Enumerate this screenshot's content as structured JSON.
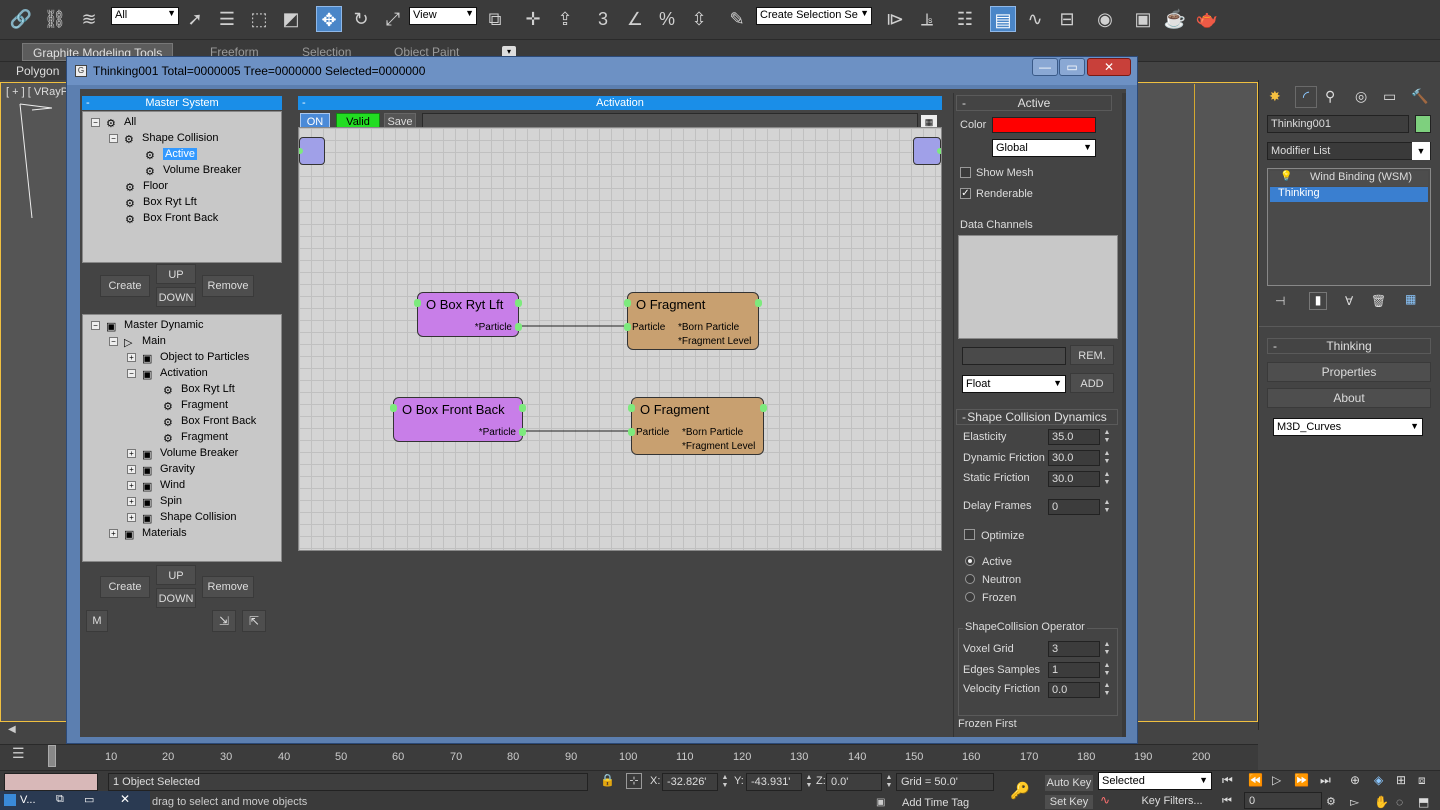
{
  "toolbar": {
    "filter_select": "All",
    "view_select": "View",
    "snap_label": "3",
    "selection_set": "Create Selection Se"
  },
  "ribbon": {
    "tabs": [
      "Graphite Modeling Tools",
      "Freeform",
      "Selection",
      "Object Paint"
    ],
    "sub_tab": "Polygon"
  },
  "viewport": {
    "label": "[ + ] [ VRayPh"
  },
  "dialog": {
    "title": "Thinking001  Total=0000005  Tree=0000000  Selected=0000000",
    "min": "—",
    "max": "▭",
    "close": "✕"
  },
  "master_system": {
    "header": "Master System",
    "items": [
      {
        "label": "All",
        "expander": "−"
      },
      {
        "label": "Shape Collision",
        "expander": "−"
      },
      {
        "label": "Active",
        "selected": true
      },
      {
        "label": "Volume Breaker"
      },
      {
        "label": "Floor"
      },
      {
        "label": "Box Ryt Lft"
      },
      {
        "label": "Box Front Back"
      }
    ],
    "create": "Create",
    "up": "UP",
    "down": "DOWN",
    "remove": "Remove"
  },
  "master_dynamic": {
    "items": [
      {
        "label": "Master Dynamic",
        "expander": "−"
      },
      {
        "label": "Main",
        "expander": "−"
      },
      {
        "label": "Object to Particles",
        "expander": "+"
      },
      {
        "label": "Activation",
        "expander": "−"
      },
      {
        "label": "Box Ryt Lft"
      },
      {
        "label": "Fragment"
      },
      {
        "label": "Box Front Back"
      },
      {
        "label": "Fragment"
      },
      {
        "label": "Volume Breaker",
        "expander": "+"
      },
      {
        "label": "Gravity",
        "expander": "+"
      },
      {
        "label": "Wind",
        "expander": "+"
      },
      {
        "label": "Spin",
        "expander": "+"
      },
      {
        "label": "Shape Collision",
        "expander": "+"
      },
      {
        "label": "Materials",
        "expander": "+"
      }
    ],
    "create": "Create",
    "up": "UP",
    "down": "DOWN",
    "remove": "Remove",
    "m": "M"
  },
  "activation": {
    "header": "Activation",
    "on": "ON",
    "valid": "Valid",
    "save": "Save",
    "nodes": [
      {
        "title": "O Box Ryt Lft",
        "port": "*Particle"
      },
      {
        "title": "O Fragment",
        "in": "Particle",
        "out1": "*Born Particle",
        "out2": "*Fragment Level"
      },
      {
        "title": "O Box Front Back",
        "port": "*Particle"
      },
      {
        "title": "O Fragment",
        "in": "Particle",
        "out1": "*Born Particle",
        "out2": "*Fragment Level"
      }
    ]
  },
  "props": {
    "active_header": "Active",
    "color_label": "Color",
    "color_value": "#ff0000",
    "space_select": "Global",
    "show_mesh": "Show Mesh",
    "renderable": "Renderable",
    "data_channels": "Data Channels",
    "rem": "REM.",
    "float_select": "Float",
    "add": "ADD",
    "scd_header": "Shape Collision Dynamics",
    "elasticity_label": "Elasticity",
    "elasticity": "35.0",
    "dyn_friction_label": "Dynamic Friction",
    "dyn_friction": "30.0",
    "static_friction_label": "Static Friction",
    "static_friction": "30.0",
    "delay_label": "Delay Frames",
    "delay": "0",
    "optimize": "Optimize",
    "radio_active": "Active",
    "radio_neutron": "Neutron",
    "radio_frozen": "Frozen",
    "op_group": "ShapeCollision Operator",
    "voxel_label": "Voxel Grid",
    "voxel": "3",
    "edges_label": "Edges Samples",
    "edges": "1",
    "vel_label": "Velocity Friction",
    "vel": "0.0",
    "frozen_first": "Frozen First"
  },
  "cmdpanel": {
    "object_name": "Thinking001",
    "modifier_list": "Modifier List",
    "stack": [
      "Wind Binding (WSM)",
      "Thinking"
    ],
    "rollout": "Thinking",
    "properties": "Properties",
    "about": "About",
    "curves_select": "M3D_Curves"
  },
  "timeline": {
    "ticks": [
      "10",
      "20",
      "30",
      "40",
      "50",
      "60",
      "70",
      "80",
      "90",
      "100",
      "110",
      "120",
      "130",
      "140",
      "150",
      "160",
      "170",
      "180",
      "190",
      "200"
    ]
  },
  "status": {
    "selected": "1 Object Selected",
    "hint": "drag to select and move objects",
    "x_label": "X:",
    "x": "-32.826'",
    "y_label": "Y:",
    "y": "-43.931'",
    "z_label": "Z:",
    "z": "0.0'",
    "grid": "Grid = 50.0'",
    "auto_key": "Auto Key",
    "set_key": "Set Key",
    "key_select": "Selected",
    "key_filters": "Key Filters...",
    "add_time_tag": "Add Time Tag",
    "frame": "0",
    "taskbar": "V..."
  }
}
